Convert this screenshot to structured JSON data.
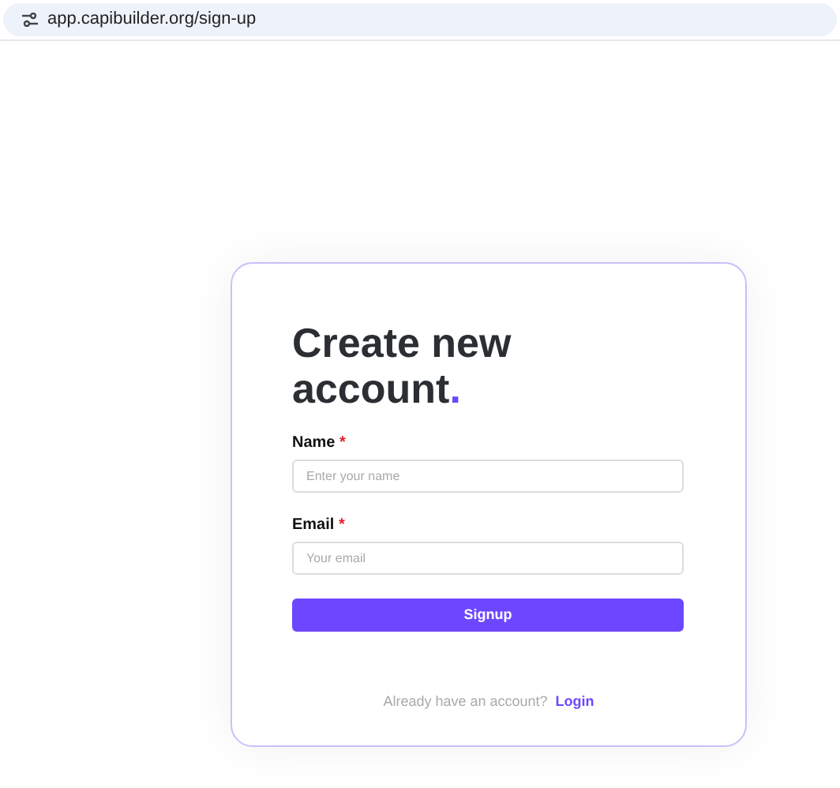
{
  "browser": {
    "url": "app.capibuilder.org/sign-up"
  },
  "form": {
    "title": "Create new account",
    "title_dot": ".",
    "fields": [
      {
        "label": "Name",
        "required_mark": "*",
        "placeholder": "Enter your name"
      },
      {
        "label": "Email",
        "required_mark": "*",
        "placeholder": "Your email"
      }
    ],
    "submit": "Signup",
    "footer_text": "Already have an account?",
    "footer_link": "Login"
  }
}
